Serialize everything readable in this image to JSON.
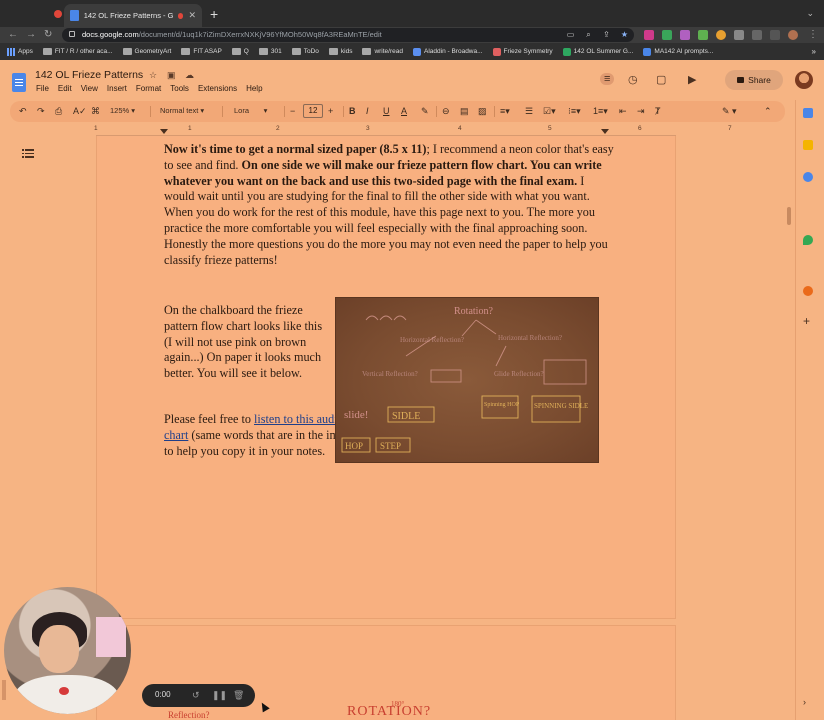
{
  "browser": {
    "tab_title": "142 OL Frieze Patterns - G",
    "url_host": "docs.google.com",
    "url_path": "/document/d/1uq1k7iZimDXerrxNXKjV96YfMOh50Wq8fA3REaMnTE/edit",
    "bookmarks": [
      "Apps",
      "FIT / R / other aca...",
      "GeometryArt",
      "FIT ASAP",
      "Q",
      "301",
      "ToDo",
      "kids",
      "write/read",
      "Aladdin - Broadwa...",
      "Frieze Symmetry",
      "142 OL Summer G...",
      "MA142 AI prompts..."
    ],
    "bookmarks_more": "»"
  },
  "docs": {
    "title": "142 OL Frieze Patterns",
    "menu": [
      "File",
      "Edit",
      "View",
      "Insert",
      "Format",
      "Tools",
      "Extensions",
      "Help"
    ],
    "share_label": "Share"
  },
  "toolbar": {
    "zoom": "125%",
    "style": "Normal text",
    "font": "Lora",
    "font_size": "12"
  },
  "ruler": {
    "numbers": [
      "1",
      "1",
      "2",
      "3",
      "4",
      "5",
      "6",
      "7"
    ]
  },
  "document": {
    "para1": {
      "b1": "Now it's time to get a normal sized paper (8.5 x 11)",
      "t1": "; I recommend a neon color that's easy to see and find. ",
      "b2": "On one side we will make our frieze pattern flow chart. You can write whatever you want on the back and use this two-sided page with the final exam.",
      "t2": " I would wait until you are studying for the final to fill the other side with what you want. When you do work for the rest of this module, have this page next to you. The more you practice the more comfortable you will feel especially with the final approaching soon. Honestly the more questions you do the more you may not even need the paper to help you classify frieze patterns!"
    },
    "para2": "On the chalkboard the frieze pattern flow chart looks like this (I will not use pink on brown again...)  On paper it looks much better. You will see it below.",
    "para3": {
      "t1": "Please feel free to ",
      "link": "listen to this audio of me reading the frieze pattern flow-chart",
      "t2": " (same words that are in the image on the FIT blackboard and below) to help you copy it in your notes."
    },
    "chalkboard": {
      "rotation": "Rotation?",
      "h_reflection_left": "Horizontal Reflection?",
      "h_reflection_right": "Horizontal Reflection?",
      "v_reflection": "Vertical Reflection?",
      "glide": "Glide Reflection?",
      "slide": "slide!",
      "slide_box": "SIDLE",
      "hop": "HOP",
      "step": "STEP",
      "jump": "Spinning HOP",
      "spinning_sidle": "SPINNING SIDLE"
    },
    "page2_preview": {
      "left": "Reflection?",
      "rotation": "ROTATION?",
      "degree": "180°"
    }
  },
  "recorder": {
    "time": "0:00"
  },
  "colors": {
    "page_background": "#f6b483",
    "chalk_pink": "#e8a0a0",
    "chalk_yellow": "#f0c060"
  }
}
